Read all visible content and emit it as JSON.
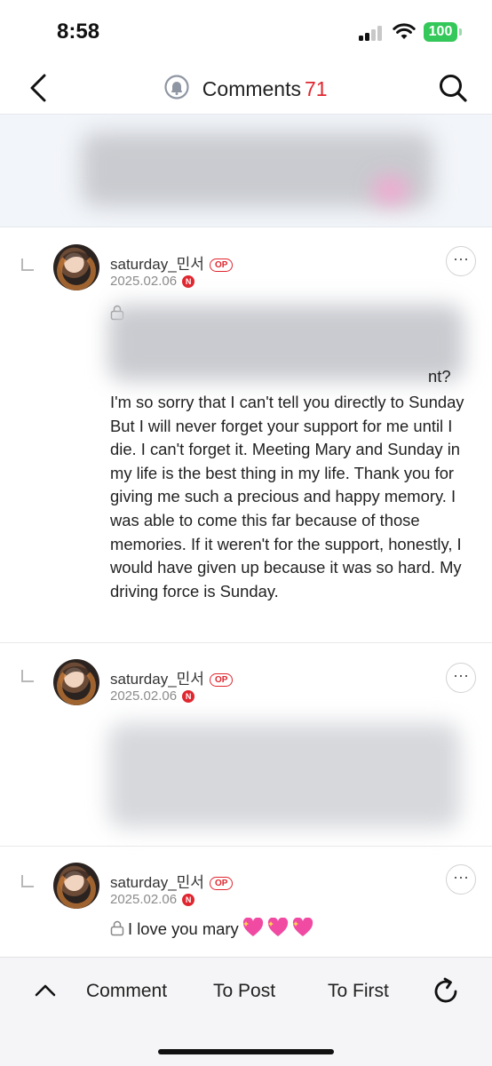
{
  "status_bar": {
    "time": "8:58",
    "battery": "100",
    "icons": [
      "signal-icon",
      "wifi-icon",
      "battery-icon"
    ]
  },
  "header": {
    "title": "Comments",
    "count": "71",
    "icons": [
      "back-arrow-icon",
      "bell-icon",
      "search-icon"
    ]
  },
  "comments": [
    {
      "username": "saturday_민서",
      "op_label": "OP",
      "date": "2025.02.06",
      "n_badge": "N",
      "visible_text": "I'm so sorry that I can't tell you directly to Sunday But I will never forget your support for me until I die. I can't forget it. Meeting Mary and Sunday in my life is the best thing in my life. Thank you for giving me such a precious and happy memory. I was able to come this far because of those memories. If it weren't for the support, honestly, I would have given up because it was so hard. My driving force is Sunday.",
      "partial_end": "nt?"
    },
    {
      "username": "saturday_민서",
      "op_label": "OP",
      "date": "2025.02.06",
      "n_badge": "N"
    },
    {
      "username": "saturday_민서",
      "op_label": "OP",
      "date": "2025.02.06",
      "n_badge": "N",
      "text": "I love you mary"
    }
  ],
  "bottom_bar": {
    "comment_label": "Comment",
    "to_post_label": "To Post",
    "to_first_label": "To First"
  },
  "colors": {
    "accent": "#e0262f",
    "battery": "#34c759",
    "notice_bg": "#f2f5f9"
  }
}
